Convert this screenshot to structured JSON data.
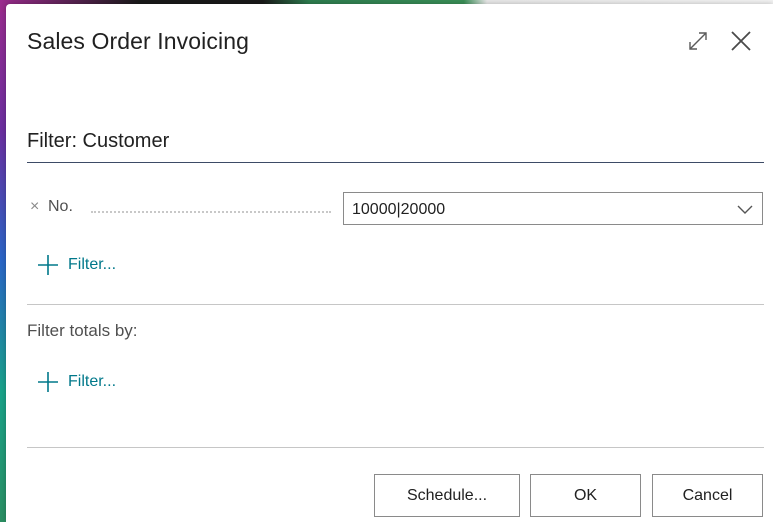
{
  "dialog": {
    "title": "Sales Order Invoicing",
    "expand_icon": "expand-icon",
    "close_icon": "close-icon"
  },
  "customer_filter": {
    "section_title": "Filter: Customer",
    "field_label": "No.",
    "remove_glyph": "×",
    "value": "10000|20000",
    "add_filter_label": "Filter..."
  },
  "totals_filter": {
    "label": "Filter totals by:",
    "add_filter_label": "Filter..."
  },
  "buttons": {
    "schedule": "Schedule...",
    "ok": "OK",
    "cancel": "Cancel"
  },
  "colors": {
    "link": "#00788a",
    "section_rule": "#3d4b66"
  }
}
